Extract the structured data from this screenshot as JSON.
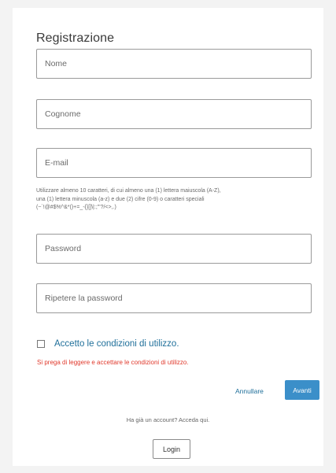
{
  "form": {
    "title": "Registrazione",
    "fields": {
      "first_name": {
        "placeholder": "Nome"
      },
      "last_name": {
        "placeholder": "Cognome"
      },
      "email": {
        "placeholder": "E-mail"
      },
      "password": {
        "placeholder": "Password"
      },
      "password_repeat": {
        "placeholder": "Ripetere la password"
      }
    },
    "password_hint": [
      "Utilizzare almeno 10 caratteri, di cui almeno una (1) lettera maiuscola (A-Z),",
      "una (1) lettera minuscola (a-z) e due (2) cifre (0-9) o caratteri speciali",
      "(~`!@#$%^&*()+=_-{}[]\\|:;\"'?/<>,.)"
    ],
    "terms_label": "Accetto le condizioni di utilizzo.",
    "terms_checked": false,
    "error_message": "Si prega di leggere e accettare le condizioni di utilizzo.",
    "cancel_label": "Annullare",
    "next_label": "Avanti",
    "account_prompt": "Ha già un account? Acceda qui.",
    "login_label": "Login"
  },
  "colors": {
    "primary": "#3b8fc9",
    "link": "#1f6f9a",
    "error": "#e0392c",
    "background": "#f3f3f3"
  }
}
